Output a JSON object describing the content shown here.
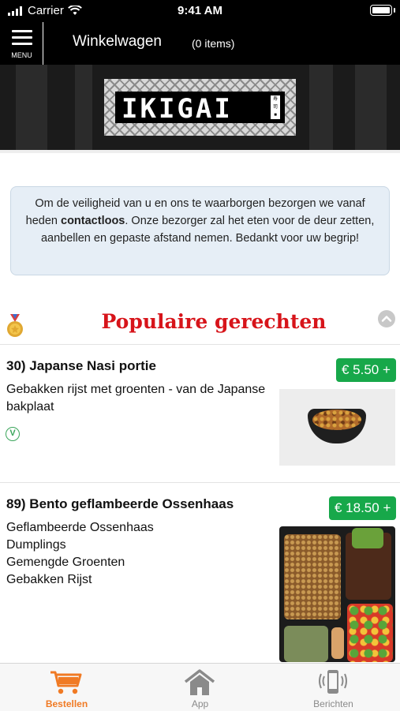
{
  "status_bar": {
    "carrier": "Carrier",
    "time": "9:41 AM"
  },
  "header": {
    "menu_label": "MENU",
    "title": "Winkelwagen",
    "items_count": "(0 items)"
  },
  "brand": {
    "logo_text": "IKIGAI"
  },
  "notice": {
    "text_before": "Om de veiligheid van u en ons te waarborgen bezorgen we vanaf heden ",
    "text_bold": "contactloos",
    "text_after": ". Onze bezorger zal het eten voor de deur zetten, aanbellen en gepaste afstand nemen. Bedankt voor uw begrip!"
  },
  "section": {
    "title": "Populaire gerechten"
  },
  "products": [
    {
      "title": "30)  Japanse Nasi portie",
      "price": "€ 5.50 +",
      "description": [
        "Gebakken rijst met groenten - van de Japanse bakplaat"
      ],
      "vegetarian": true
    },
    {
      "title": "89)  Bento geflambeerde Ossenhaas",
      "price": "€ 18.50 +",
      "description": [
        "Geflambeerde Ossenhaas",
        "Dumplings",
        "Gemengde Groenten",
        "Gebakken Rijst"
      ],
      "vegetarian": false
    }
  ],
  "tabs": [
    {
      "label": "Bestellen",
      "icon": "cart-icon",
      "active": true
    },
    {
      "label": "App",
      "icon": "home-icon",
      "active": false
    },
    {
      "label": "Berichten",
      "icon": "phone-notification-icon",
      "active": false
    }
  ],
  "colors": {
    "accent_orange": "#f07a24",
    "section_red": "#d7141a",
    "price_green": "#17a84a",
    "inactive_gray": "#8a8a8a"
  }
}
